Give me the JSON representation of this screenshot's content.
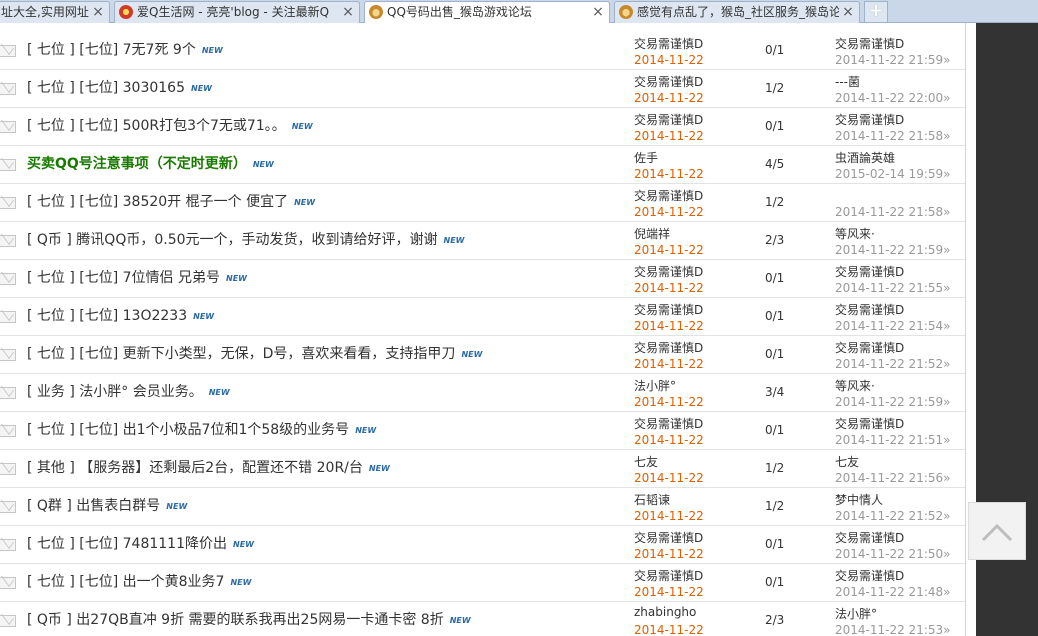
{
  "tabs": [
    {
      "title": "址大全,实用网址",
      "favicon": "none",
      "active": false
    },
    {
      "title": "爱Q生活网 - 亮亮'blog - 关注最新Q",
      "favicon": "red",
      "active": false
    },
    {
      "title": "QQ号码出售_猴岛游戏论坛",
      "favicon": "monkey",
      "active": true
    },
    {
      "title": "感觉有点乱了，猴岛_社区服务_猴岛论",
      "favicon": "monkey",
      "active": false
    }
  ],
  "new_tab_label": "+",
  "close_glyph": "×",
  "new_badge": "NEW",
  "threads": [
    {
      "subject": "[ 七位 ] [七位] 7无7死 9个",
      "highlight": false,
      "author": "交易需谨慎D",
      "post_date": "2014-11-22",
      "count": "0/1",
      "last_user": "交易需谨慎D",
      "last_time": "2014-11-22 21:59»"
    },
    {
      "subject": "[ 七位 ] [七位] 3030165",
      "highlight": false,
      "author": "交易需谨慎D",
      "post_date": "2014-11-22",
      "count": "1/2",
      "last_user": "---菌",
      "last_time": "2014-11-22 22:00»"
    },
    {
      "subject": "[ 七位 ] [七位] 500R打包3个7无或71。。",
      "highlight": false,
      "author": "交易需谨慎D",
      "post_date": "2014-11-22",
      "count": "0/1",
      "last_user": "交易需谨慎D",
      "last_time": "2014-11-22 21:58»"
    },
    {
      "subject": "买卖QQ号注意事项（不定时更新）",
      "highlight": true,
      "author": "佐手",
      "post_date": "2014-11-22",
      "count": "4/5",
      "last_user": "虫酒論英雄",
      "last_time": "2015-02-14 19:59»"
    },
    {
      "subject": "[ 七位 ] [七位] 38520开 棍子一个 便宜了",
      "highlight": false,
      "author": "交易需谨慎D",
      "post_date": "2014-11-22",
      "count": "1/2",
      "last_user": "",
      "last_time": "2014-11-22 21:58»"
    },
    {
      "subject": "[ Q币 ] 腾讯QQ币，0.50元一个，手动发货，收到请给好评，谢谢",
      "highlight": false,
      "author": "倪端祥",
      "post_date": "2014-11-22",
      "count": "2/3",
      "last_user": "等风来·",
      "last_time": "2014-11-22 21:59»"
    },
    {
      "subject": "[ 七位 ] [七位] 7位情侣 兄弟号",
      "highlight": false,
      "author": "交易需谨慎D",
      "post_date": "2014-11-22",
      "count": "0/1",
      "last_user": "交易需谨慎D",
      "last_time": "2014-11-22 21:55»"
    },
    {
      "subject": "[ 七位 ] [七位] 13O2233",
      "highlight": false,
      "author": "交易需谨慎D",
      "post_date": "2014-11-22",
      "count": "0/1",
      "last_user": "交易需谨慎D",
      "last_time": "2014-11-22 21:54»"
    },
    {
      "subject": "[ 七位 ] [七位] 更新下小类型，无保，D号，喜欢来看看，支持指甲刀",
      "highlight": false,
      "author": "交易需谨慎D",
      "post_date": "2014-11-22",
      "count": "0/1",
      "last_user": "交易需谨慎D",
      "last_time": "2014-11-22 21:52»"
    },
    {
      "subject": "[ 业务 ] 法小胖° 会员业务。",
      "highlight": false,
      "author": "法小胖°",
      "post_date": "2014-11-22",
      "count": "3/4",
      "last_user": "等风来·",
      "last_time": "2014-11-22 21:59»"
    },
    {
      "subject": "[ 七位 ] [七位] 出1个小极品7位和1个58级的业务号",
      "highlight": false,
      "author": "交易需谨慎D",
      "post_date": "2014-11-22",
      "count": "0/1",
      "last_user": "交易需谨慎D",
      "last_time": "2014-11-22 21:51»"
    },
    {
      "subject": "[ 其他 ] 【服务器】还剩最后2台，配置还不错 20R/台",
      "highlight": false,
      "author": "七友",
      "post_date": "2014-11-22",
      "count": "1/2",
      "last_user": "七友",
      "last_time": "2014-11-22 21:56»"
    },
    {
      "subject": "[ Q群 ] 出售表白群号",
      "highlight": false,
      "author": "石韬谏",
      "post_date": "2014-11-22",
      "count": "1/2",
      "last_user": "梦中情人",
      "last_time": "2014-11-22 21:52»"
    },
    {
      "subject": "[ 七位 ] [七位] 7481111降价出",
      "highlight": false,
      "author": "交易需谨慎D",
      "post_date": "2014-11-22",
      "count": "0/1",
      "last_user": "交易需谨慎D",
      "last_time": "2014-11-22 21:50»"
    },
    {
      "subject": "[ 七位 ] [七位] 出一个黄8业务7",
      "highlight": false,
      "author": "交易需谨慎D",
      "post_date": "2014-11-22",
      "count": "0/1",
      "last_user": "交易需谨慎D",
      "last_time": "2014-11-22 21:48»"
    },
    {
      "subject": "[ Q币 ] 出27QB直冲  9折 需要的联系我再出25网易一卡通卡密 8折",
      "highlight": false,
      "author": "zhabingho",
      "post_date": "2014-11-22",
      "count": "2/3",
      "last_user": "法小胖°",
      "last_time": "2014-11-22 21:53»"
    }
  ],
  "back_to_top_icon": "chevron-up-icon"
}
